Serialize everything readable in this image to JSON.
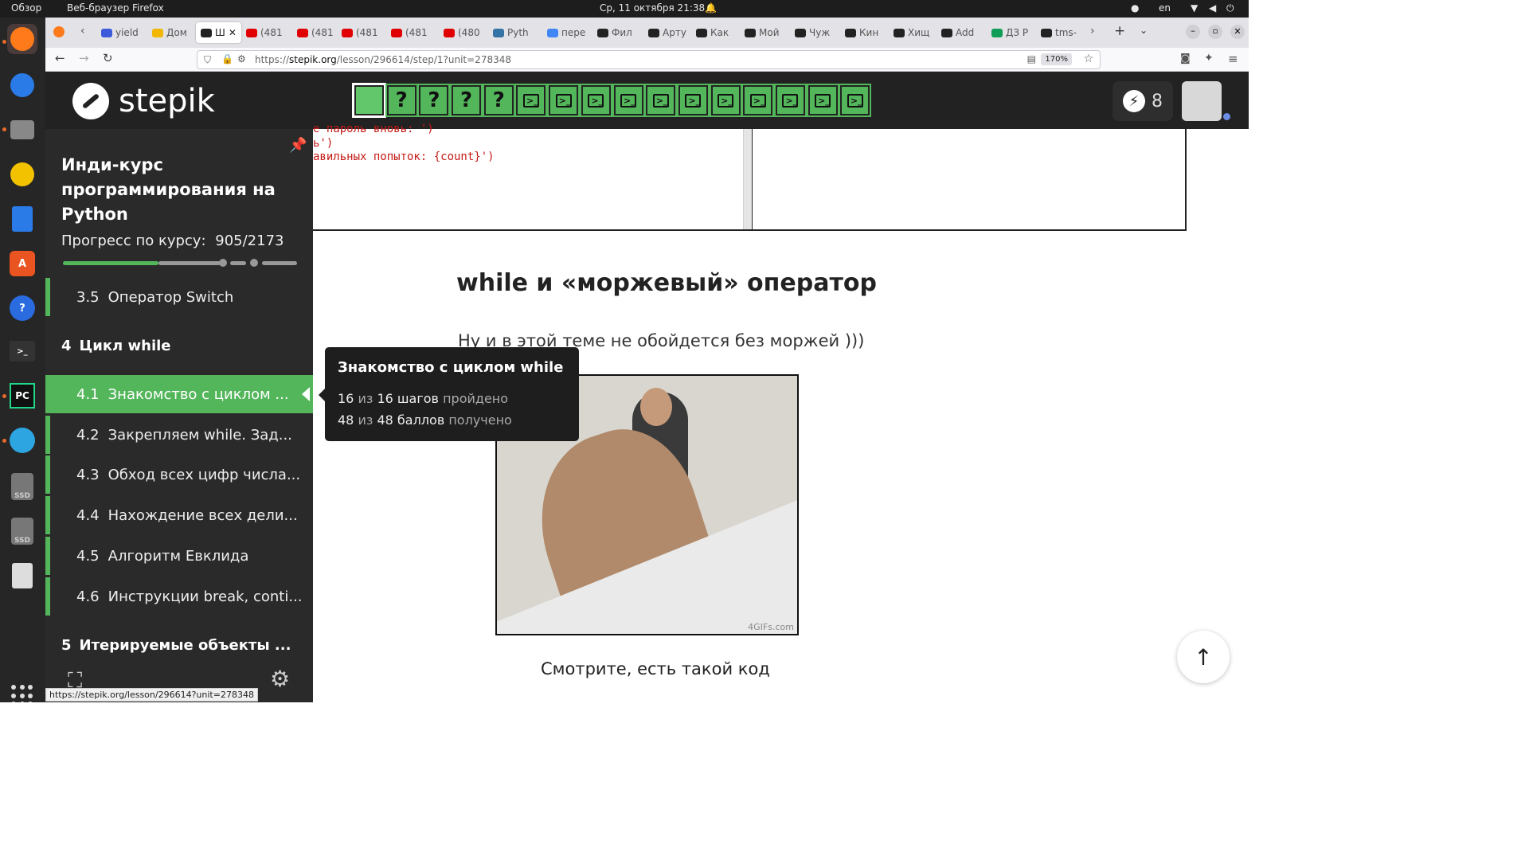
{
  "system_bar": {
    "overview": "Обзор",
    "app": "Веб-браузер Firefox",
    "datetime": "Ср, 11 октября  21:38",
    "lang": "en"
  },
  "tabs": [
    {
      "label": "yield",
      "color": "#3b5bdb"
    },
    {
      "label": "Дом",
      "color": "#f2b705"
    },
    {
      "label": "Ш",
      "color": "#222222"
    },
    {
      "label": "(481",
      "color": "#e00000"
    },
    {
      "label": "(481",
      "color": "#e00000"
    },
    {
      "label": "(481",
      "color": "#e00000"
    },
    {
      "label": "(481",
      "color": "#e00000"
    },
    {
      "label": "(480",
      "color": "#e00000"
    },
    {
      "label": "Pyth",
      "color": "#3572a5"
    },
    {
      "label": "пере",
      "color": "#4285f4"
    },
    {
      "label": "Фил",
      "color": "#222222"
    },
    {
      "label": "Арту",
      "color": "#222222"
    },
    {
      "label": "Как",
      "color": "#222222"
    },
    {
      "label": "Мой",
      "color": "#222222"
    },
    {
      "label": "Чуж",
      "color": "#222222"
    },
    {
      "label": "Кин",
      "color": "#222222"
    },
    {
      "label": "Хищ",
      "color": "#222222"
    },
    {
      "label": "Add",
      "color": "#222222"
    },
    {
      "label": "ДЗ Р",
      "color": "#0f9d58"
    },
    {
      "label": "tms-",
      "color": "#222222"
    }
  ],
  "navbar": {
    "url_prefix": "https://",
    "url_host": "stepik.org",
    "url_path": "/lesson/296614/step/1?unit=278348",
    "zoom": "170%"
  },
  "header": {
    "brand": "stepik",
    "energy": "8"
  },
  "steps": [
    {
      "type": "done",
      "label": ""
    },
    {
      "type": "quiz",
      "label": "?"
    },
    {
      "type": "quiz",
      "label": "?"
    },
    {
      "type": "quiz",
      "label": "?"
    },
    {
      "type": "quiz",
      "label": "?"
    },
    {
      "type": "code",
      "label": ">_"
    },
    {
      "type": "code",
      "label": ">_"
    },
    {
      "type": "code",
      "label": ">_"
    },
    {
      "type": "code",
      "label": ">_"
    },
    {
      "type": "code",
      "label": ">_"
    },
    {
      "type": "code",
      "label": ">_"
    },
    {
      "type": "code",
      "label": ">_"
    },
    {
      "type": "code",
      "label": ">_"
    },
    {
      "type": "code",
      "label": ">_"
    },
    {
      "type": "code",
      "label": ">_"
    },
    {
      "type": "code",
      "label": ">_"
    }
  ],
  "sidebar": {
    "course_title": "Инди-курс программирования на Python",
    "progress_label": "Прогресс по курсу:",
    "progress_value": "905/2173",
    "lessons": [
      {
        "num": "3.5",
        "title": "Оператор Switch"
      },
      {
        "num": "4",
        "title": "Цикл while",
        "section": true
      },
      {
        "num": "4.1",
        "title": "Знакомство с циклом ...",
        "active": true
      },
      {
        "num": "4.2",
        "title": "Закрепляем while. Зад..."
      },
      {
        "num": "4.3",
        "title": "Обход всех цифр числа..."
      },
      {
        "num": "4.4",
        "title": "Нахождение всех дели..."
      },
      {
        "num": "4.5",
        "title": "Алгоритм Евклида"
      },
      {
        "num": "4.6",
        "title": "Инструкции break, conti..."
      },
      {
        "num": "5",
        "title": "Итерируемые объекты ...",
        "section": true
      }
    ]
  },
  "tooltip": {
    "title": "Знакомство с циклом while",
    "steps_done": "16",
    "steps_of": "из",
    "steps_total": "16",
    "steps_word": "шагов",
    "steps_status": "пройдено",
    "points_done": "48",
    "points_of": "из",
    "points_total": "48",
    "points_word": "баллов",
    "points_status": "получено"
  },
  "content": {
    "code_lines": [
      "е пароль вновь: ')",
      "ь')",
      "авильных попыток: {count}')"
    ],
    "heading": "while и «моржевый» оператор",
    "intro": "Ну и в этой теме не обойдется без моржей )))",
    "gif_watermark": "4GIFs.com",
    "after_gif": "Смотрите, есть такой код"
  },
  "status_url": "https://stepik.org/lesson/296614?unit=278348"
}
